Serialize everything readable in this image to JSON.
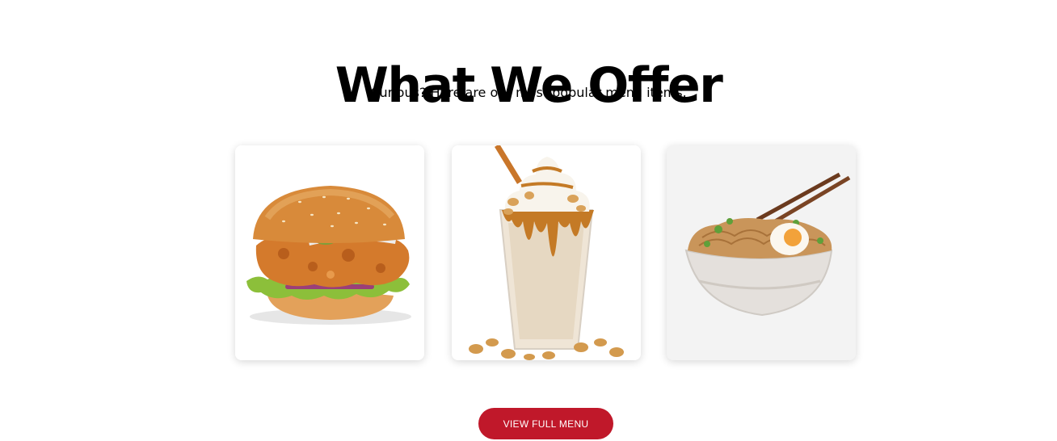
{
  "section": {
    "title": "What We Offer",
    "subtitle": "Curious? Here are our most popular menu items."
  },
  "menu_items": [
    {
      "image": "fried-chicken-burger"
    },
    {
      "image": "caramel-peanut-milkshake"
    },
    {
      "image": "noodle-bowl-with-egg"
    }
  ],
  "cta": {
    "label": "VIEW FULL MENU",
    "color": "#c0182a"
  }
}
